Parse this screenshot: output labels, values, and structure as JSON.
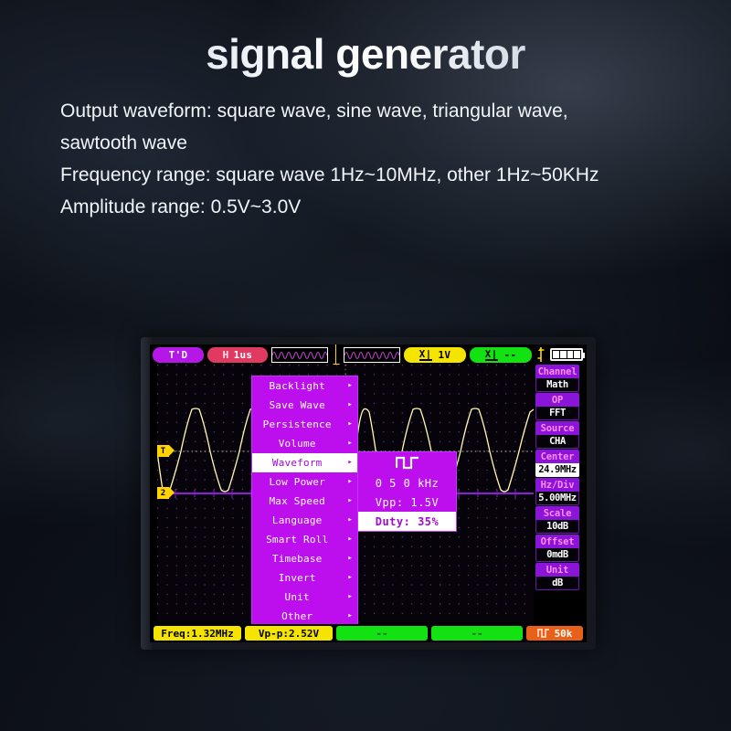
{
  "header": {
    "title": "signal generator",
    "lines": [
      "Output waveform: square wave, sine wave, triangular wave,\nsawtooth wave",
      "Frequency range: square wave 1Hz~10MHz, other 1Hz~50KHz",
      "Amplitude range: 0.5V~3.0V"
    ]
  },
  "colors": {
    "menu_purple": "#bd0fee",
    "sidebar_purple": "#8a14d8",
    "sidebar_label_text": "#ff8cf5",
    "trace_yellow": "#fff8b0",
    "ch1_yellow": "#f5e400",
    "ch2_green": "#12e212",
    "orange": "#e8601a",
    "pink_red": "#e03a63",
    "grid_dot": "#7a3fa0"
  },
  "device": {
    "topbar": {
      "trigger_status": "T'D",
      "hold_label": "H",
      "timebase": "1us",
      "preview_left_icon": "sine-wave-preview",
      "preview_right_icon": "sine-wave-preview",
      "ch1_icon": "channel-1-icon",
      "ch1_value": "1V",
      "ch2_icon": "channel-2-icon",
      "ch2_value": "--",
      "trigger_icon": "trigger-edge-icon",
      "battery_icon": "battery-icon",
      "battery_segments": 4
    },
    "plot": {
      "marker_trigger": "T",
      "marker_channel": "2"
    },
    "menu": {
      "items": [
        {
          "label": "Backlight",
          "selected": false,
          "arrow": "▸"
        },
        {
          "label": "Save Wave",
          "selected": false,
          "arrow": "▸"
        },
        {
          "label": "Persistence",
          "selected": false,
          "arrow": "▸"
        },
        {
          "label": "Volume",
          "selected": false,
          "arrow": "▸"
        },
        {
          "label": "Waveform",
          "selected": true,
          "arrow": "▸"
        },
        {
          "label": "Low Power",
          "selected": false,
          "arrow": "▸"
        },
        {
          "label": "Max Speed",
          "selected": false,
          "arrow": "▸"
        },
        {
          "label": "Language",
          "selected": false,
          "arrow": "▸"
        },
        {
          "label": "Smart Roll",
          "selected": false,
          "arrow": "▸"
        },
        {
          "label": "Timebase",
          "selected": false,
          "arrow": "▸"
        },
        {
          "label": "Invert",
          "selected": false,
          "arrow": "▸"
        },
        {
          "label": "Unit",
          "selected": false,
          "arrow": "▸"
        },
        {
          "label": "Other",
          "selected": false,
          "arrow": "▸"
        }
      ]
    },
    "submenu": {
      "icon": "square-wave-icon",
      "frequency": "0 5 0 kHz",
      "amplitude": "Vpp: 1.5V",
      "duty": "Duty: 35%"
    },
    "sidebar": [
      {
        "label": "Channel",
        "value": "Math",
        "highlighted": false
      },
      {
        "label": "OP",
        "value": "FFT",
        "highlighted": false
      },
      {
        "label": "Source",
        "value": "CHA",
        "highlighted": false
      },
      {
        "label": "Center",
        "value": "24.9MHz",
        "highlighted": true
      },
      {
        "label": "Hz/Div",
        "value": "5.00MHz",
        "highlighted": false
      },
      {
        "label": "Scale",
        "value": "10dB",
        "highlighted": false
      },
      {
        "label": "Offset",
        "value": "0mdB",
        "highlighted": false
      },
      {
        "label": "Unit",
        "value": "dB",
        "highlighted": false
      }
    ],
    "bottombar": {
      "freq": "Freq:1.32MHz",
      "vpp": "Vp-p:2.52V",
      "field3": "--",
      "field4": "--",
      "gen_icon": "square-wave-icon",
      "gen_value": "50k"
    }
  }
}
